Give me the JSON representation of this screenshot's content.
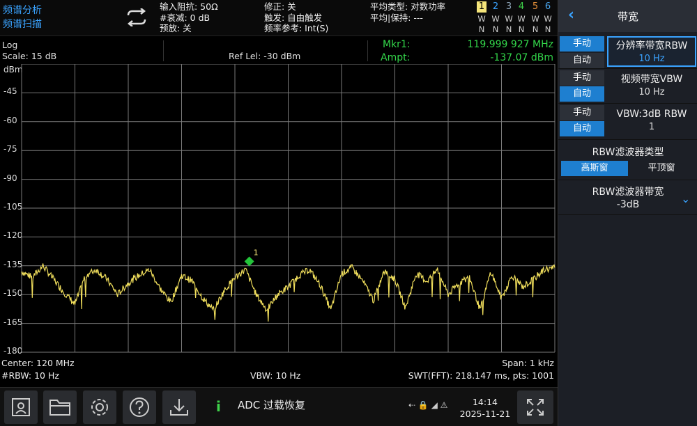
{
  "mode": {
    "line1": "频谱分析",
    "line2": "频谱扫描"
  },
  "top": {
    "col1": [
      "输入阻抗: 50Ω",
      "#衰减: 0 dB",
      "预放: 关"
    ],
    "col2": [
      "修正: 关",
      "触发: 自由触发",
      "频率参考: Int(S)"
    ],
    "col3": [
      "平均类型: 对数功率",
      "平均|保持: ---"
    ]
  },
  "traces": {
    "numbers": [
      "1",
      "2",
      "3",
      "4",
      "5",
      "6"
    ],
    "row_w": [
      "W",
      "W",
      "W",
      "W",
      "W",
      "W"
    ],
    "row_n": [
      "N",
      "N",
      "N",
      "N",
      "N",
      "N"
    ],
    "colors": [
      "#f5e57a",
      "#3aa3ff",
      "#8fa5b8",
      "#3fd24a",
      "#e8923a",
      "#4aa8f0"
    ]
  },
  "info": {
    "scale_type": "Log",
    "scale": "Scale: 15 dB",
    "ref_level": "Ref Lel: -30 dBm",
    "marker_label": "Mkr1:",
    "marker_freq": "119.999 927 MHz",
    "ampt_label": "Ampt:",
    "ampt_value": "-137.07 dBm"
  },
  "graph": {
    "unit": "dBm",
    "y_labels": [
      "-45",
      "-60",
      "-75",
      "-90",
      "-105",
      "-120",
      "-135",
      "-150",
      "-165",
      "-180"
    ],
    "marker_id": "1"
  },
  "chart_data": {
    "type": "line",
    "ylabel": "dBm",
    "ylim": [
      -180,
      -30
    ],
    "xlim": [
      119.9995,
      120.0005
    ],
    "series": [
      {
        "values": [
          [
            119.9995,
            -138
          ],
          [
            119.99952,
            -141
          ],
          [
            119.99954,
            -135
          ],
          [
            119.99956,
            -142
          ],
          [
            119.99958,
            -149
          ],
          [
            119.9996,
            -155
          ],
          [
            119.99962,
            -140
          ],
          [
            119.99964,
            -137
          ],
          [
            119.99966,
            -142
          ],
          [
            119.99968,
            -150
          ],
          [
            119.9997,
            -144
          ],
          [
            119.99972,
            -140
          ],
          [
            119.99974,
            -137
          ],
          [
            119.99976,
            -147
          ],
          [
            119.99978,
            -154
          ],
          [
            119.9998,
            -140
          ],
          [
            119.99982,
            -143
          ],
          [
            119.99984,
            -152
          ],
          [
            119.99986,
            -158
          ],
          [
            119.99988,
            -148
          ],
          [
            119.9999,
            -141
          ],
          [
            119.99992,
            -137
          ],
          [
            119.99994,
            -150
          ],
          [
            119.99996,
            -158
          ],
          [
            119.99998,
            -150
          ],
          [
            120.0,
            -146
          ],
          [
            120.00002,
            -140
          ],
          [
            120.00004,
            -137
          ],
          [
            120.00006,
            -145
          ],
          [
            120.00008,
            -158
          ],
          [
            120.0001,
            -139
          ],
          [
            120.00012,
            -136
          ],
          [
            120.00014,
            -143
          ],
          [
            120.00016,
            -153
          ],
          [
            120.00018,
            -138
          ],
          [
            120.0002,
            -142
          ],
          [
            120.00022,
            -157
          ],
          [
            120.00024,
            -139
          ],
          [
            120.00026,
            -143
          ],
          [
            120.00028,
            -137
          ],
          [
            120.0003,
            -150
          ],
          [
            120.00032,
            -144
          ],
          [
            120.00034,
            -141
          ],
          [
            120.00036,
            -158
          ],
          [
            120.00038,
            -138
          ],
          [
            120.0004,
            -152
          ],
          [
            120.00042,
            -140
          ],
          [
            120.00044,
            -146
          ],
          [
            120.00046,
            -142
          ],
          [
            120.00048,
            -137
          ],
          [
            120.0005,
            -136
          ]
        ]
      }
    ]
  },
  "bottom": {
    "center": "Center: 120 MHz",
    "rbw": "#RBW: 10 Hz",
    "vbw": "VBW: 10 Hz",
    "span": "Span: 1 kHz",
    "swt": "SWT(FFT): 218.147 ms, pts: 1001"
  },
  "toolbar": {
    "message": "ADC 过载恢复",
    "time": "14:14",
    "date": "2025-11-21",
    "status_icons": "⇠ 🔒 ◢ ⚠"
  },
  "panel": {
    "title": "带宽",
    "manual": "手动",
    "auto": "自动",
    "rbw_title": "分辨率带宽RBW",
    "rbw_value": "10 Hz",
    "vbw_title": "视频带宽VBW",
    "vbw_value": "10 Hz",
    "ratio_title": "VBW:3dB RBW",
    "ratio_value": "1",
    "filter_type_title": "RBW滤波器类型",
    "filter_gauss": "高斯窗",
    "filter_flat": "平顶窗",
    "filter_bw_title": "RBW滤波器带宽",
    "filter_bw_value": "-3dB"
  }
}
